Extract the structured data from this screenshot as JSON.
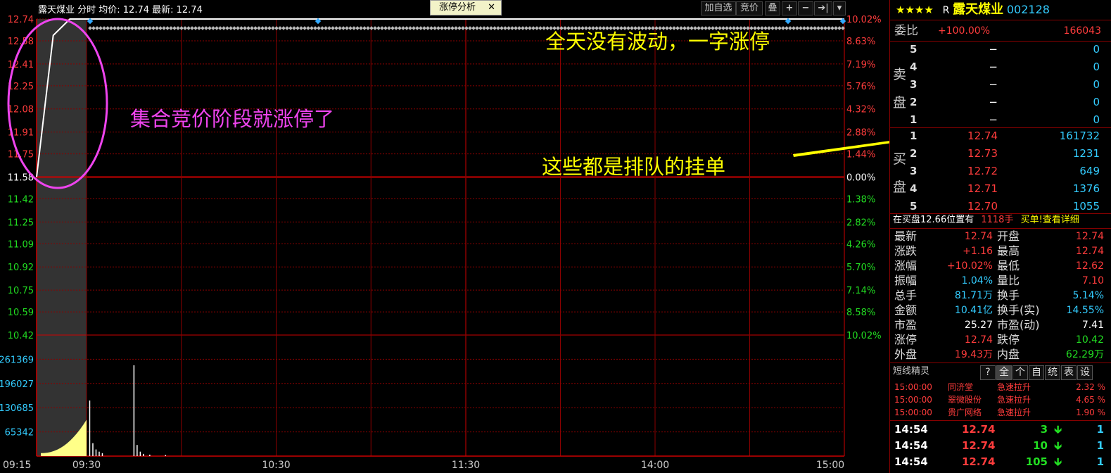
{
  "header": {
    "stock_title": "露天煤业 分时 均价: 12.74 最新: 12.74",
    "tab_label": "涨停分析",
    "tab_close": "✕",
    "btn_add_fav": "加自选",
    "btn_auction": "竞价",
    "btn_overlay": "叠",
    "btn_plus": "+",
    "btn_minus": "−",
    "btn_forward": "➔|",
    "btn_down": "▾"
  },
  "colors": {
    "up": "#ff3c3c",
    "down": "#22dd22",
    "volume": "#33ccff",
    "grid": "#8b0000",
    "auction_shade": "#333333",
    "annotation_yellow": "#ffff00",
    "annotation_magenta": "#ee44ee"
  },
  "annotations": {
    "no_fluctuation": "全天没有波动，一字涨停",
    "auction_limit_up": "集合竞价阶段就涨停了",
    "queue_orders": "这些都是排队的挂单"
  },
  "chart_data": {
    "type": "line",
    "title": "露天煤业 分时",
    "prev_close": 11.58,
    "price_ticks": [
      "12.74",
      "12.58",
      "12.41",
      "12.25",
      "12.08",
      "11.91",
      "11.75",
      "11.58",
      "11.42",
      "11.25",
      "11.09",
      "10.92",
      "10.75",
      "10.59",
      "10.42"
    ],
    "pct_ticks": [
      "10.02%",
      "8.63%",
      "7.19%",
      "5.76%",
      "4.32%",
      "2.88%",
      "1.44%",
      "0.00%",
      "1.38%",
      "2.82%",
      "4.26%",
      "5.70%",
      "7.14%",
      "8.58%",
      "10.02%"
    ],
    "volume_ticks": [
      "261369",
      "196027",
      "130685",
      "65342"
    ],
    "time_ticks": [
      "09:15",
      "09:30",
      "10:30",
      "11:30",
      "14:00",
      "15:00"
    ],
    "ylim": [
      10.42,
      12.74
    ],
    "volume_ylim": [
      0,
      326711
    ],
    "series": [
      {
        "name": "价格",
        "x": [
          "09:15",
          "09:20",
          "09:25",
          "09:30",
          "15:00"
        ],
        "values": [
          11.58,
          12.62,
          12.74,
          12.74,
          12.74
        ]
      }
    ],
    "volume_bars": [
      {
        "t": "09:31",
        "v": 150000
      },
      {
        "t": "09:32",
        "v": 35000
      },
      {
        "t": "09:33",
        "v": 18000
      },
      {
        "t": "09:34",
        "v": 12000
      },
      {
        "t": "09:35",
        "v": 8000
      },
      {
        "t": "09:45",
        "v": 245000
      },
      {
        "t": "09:46",
        "v": 30000
      },
      {
        "t": "09:47",
        "v": 12000
      },
      {
        "t": "09:48",
        "v": 6000
      },
      {
        "t": "09:50",
        "v": 4000
      },
      {
        "t": "09:55",
        "v": 3000
      }
    ]
  },
  "quote": {
    "stars": "★★★★",
    "r_label": "R",
    "name": "露天煤业",
    "code": "002128",
    "weibi_label": "委比",
    "weibi_pct": "+100.00%",
    "weibi_val": "166043",
    "sell_label": "卖盘",
    "buy_label": "买盘",
    "sell": [
      {
        "lvl": "5",
        "price": "−",
        "vol": "0"
      },
      {
        "lvl": "4",
        "price": "−",
        "vol": "0"
      },
      {
        "lvl": "3",
        "price": "−",
        "vol": "0"
      },
      {
        "lvl": "2",
        "price": "−",
        "vol": "0"
      },
      {
        "lvl": "1",
        "price": "−",
        "vol": "0"
      }
    ],
    "buy": [
      {
        "lvl": "1",
        "price": "12.74",
        "vol": "161732"
      },
      {
        "lvl": "2",
        "price": "12.73",
        "vol": "1231"
      },
      {
        "lvl": "3",
        "price": "12.72",
        "vol": "649"
      },
      {
        "lvl": "4",
        "price": "12.71",
        "vol": "1376"
      },
      {
        "lvl": "5",
        "price": "12.70",
        "vol": "1055"
      }
    ],
    "notice_left": "在买盘12.66位置有",
    "notice_mid": "1118手",
    "notice_right": "买单!查看详细",
    "stats": [
      {
        "l1": "最新",
        "v1": "12.74",
        "c1": "red",
        "l2": "开盘",
        "v2": "12.74",
        "c2": "red"
      },
      {
        "l1": "涨跌",
        "v1": "+1.16",
        "c1": "red",
        "l2": "最高",
        "v2": "12.74",
        "c2": "red"
      },
      {
        "l1": "涨幅",
        "v1": "+10.02%",
        "c1": "red",
        "l2": "最低",
        "v2": "12.62",
        "c2": "red"
      },
      {
        "l1": "振幅",
        "v1": "1.04%",
        "c1": "cyan",
        "l2": "量比",
        "v2": "7.10",
        "c2": "red"
      },
      {
        "l1": "总手",
        "v1": "81.71万",
        "c1": "cyan",
        "l2": "换手",
        "v2": "5.14%",
        "c2": "cyan"
      },
      {
        "l1": "金额",
        "v1": "10.41亿",
        "c1": "cyan",
        "l2": "换手(实)",
        "v2": "14.55%",
        "c2": "cyan"
      },
      {
        "l1": "市盈",
        "v1": "25.27",
        "c1": "white",
        "l2": "市盈(动)",
        "v2": "7.41",
        "c2": "white"
      },
      {
        "l1": "涨停",
        "v1": "12.74",
        "c1": "red",
        "l2": "跌停",
        "v2": "10.42",
        "c2": "green"
      },
      {
        "l1": "外盘",
        "v1": "19.43万",
        "c1": "red",
        "l2": "内盘",
        "v2": "62.29万",
        "c2": "green"
      }
    ],
    "sprite_title": "短线精灵",
    "sprite_tabs": [
      "?",
      "全",
      "个",
      "自",
      "统",
      "表",
      "设"
    ],
    "sprite_rows": [
      {
        "time": "15:00:00",
        "name": "同济堂",
        "event": "急速拉升",
        "pct": "2.32 %"
      },
      {
        "time": "15:00:00",
        "name": "翠微股份",
        "event": "急速拉升",
        "pct": "4.65 %"
      },
      {
        "time": "15:00:00",
        "name": "贵广网络",
        "event": "急速拉升",
        "pct": "1.90 %"
      }
    ],
    "ticks": [
      {
        "time": "14:54",
        "price": "12.74",
        "vol": "3",
        "arrow": "down-arrow",
        "n": "1"
      },
      {
        "time": "14:54",
        "price": "12.74",
        "vol": "10",
        "arrow": "down-arrow",
        "n": "1"
      },
      {
        "time": "14:54",
        "price": "12.74",
        "vol": "105",
        "arrow": "down-arrow",
        "n": "1"
      }
    ]
  }
}
